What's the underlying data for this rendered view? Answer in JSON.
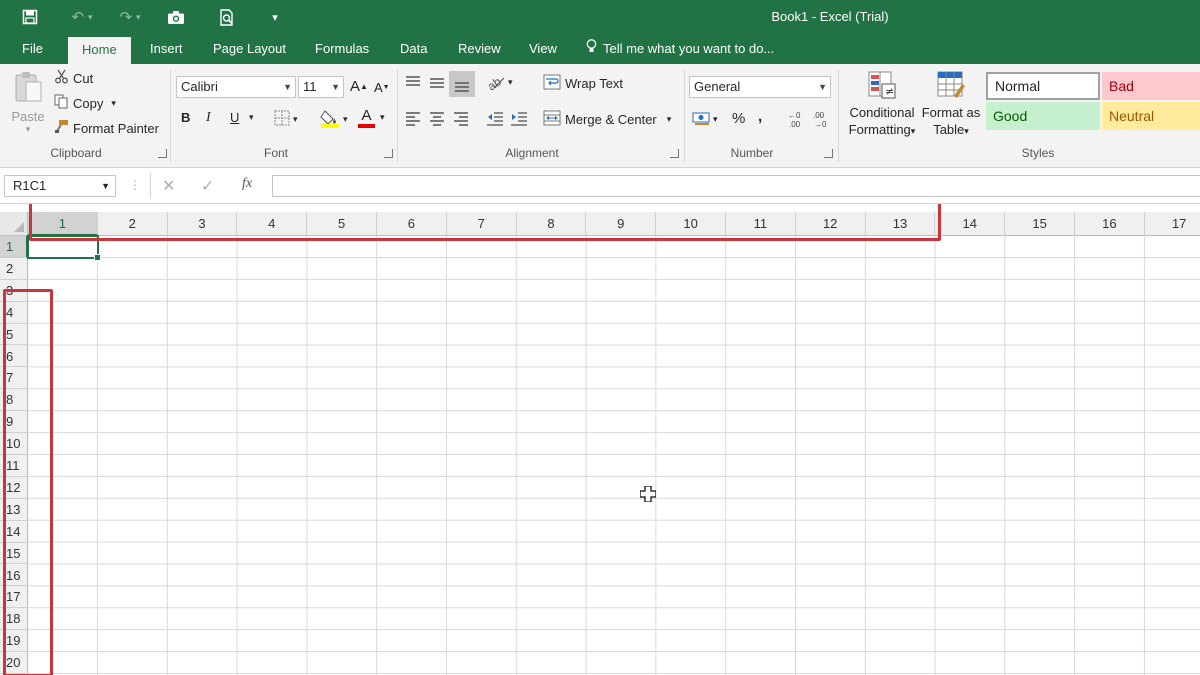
{
  "window": {
    "title": "Book1 - Excel (Trial)"
  },
  "quick_access": {
    "save_icon": "save-icon",
    "undo_icon": "undo-icon",
    "redo_icon": "redo-icon",
    "camera_icon": "camera-icon",
    "print_preview_icon": "print-preview-icon",
    "customize_icon": "customize-qat-icon"
  },
  "tabs": [
    "File",
    "Home",
    "Insert",
    "Page Layout",
    "Formulas",
    "Data",
    "Review",
    "View"
  ],
  "active_tab": "Home",
  "tell_me": "Tell me what you want to do...",
  "ribbon": {
    "clipboard": {
      "paste": "Paste",
      "cut": "Cut",
      "copy": "Copy",
      "format_painter": "Format Painter",
      "label": "Clipboard"
    },
    "font": {
      "name": "Calibri",
      "size": "11",
      "bold": "B",
      "italic": "I",
      "underline": "U",
      "grow": "A",
      "shrink": "A",
      "font_color_letter": "A",
      "label": "Font"
    },
    "alignment": {
      "wrap_text": "Wrap Text",
      "merge_center": "Merge & Center",
      "label": "Alignment"
    },
    "number": {
      "format": "General",
      "percent": "%",
      "comma": ",",
      "label": "Number"
    },
    "styles": {
      "conditional_formatting_1": "Conditional",
      "conditional_formatting_2": "Formatting",
      "format_as_table_1": "Format as",
      "format_as_table_2": "Table",
      "normal": "Normal",
      "bad": "Bad",
      "good": "Good",
      "neutral": "Neutral",
      "label": "Styles",
      "colors": {
        "normal_bg": "#ffffff",
        "bad_bg": "#ffc7ce",
        "bad_fg": "#9c0006",
        "good_bg": "#c6efce",
        "good_fg": "#006100",
        "neutral_bg": "#ffeb9c",
        "neutral_fg": "#9c5700"
      }
    }
  },
  "formula_bar": {
    "name_box": "R1C1",
    "fx": "fx",
    "value": ""
  },
  "grid": {
    "columns": [
      "1",
      "2",
      "3",
      "4",
      "5",
      "6",
      "7",
      "8",
      "9",
      "10",
      "11",
      "12",
      "13",
      "14",
      "15",
      "16",
      "17"
    ],
    "rows": [
      "1",
      "2",
      "3",
      "4",
      "5",
      "6",
      "7",
      "8",
      "9",
      "10",
      "11",
      "12",
      "13",
      "14",
      "15",
      "16",
      "17",
      "18",
      "19",
      "20"
    ],
    "selected_cell": "R1C1"
  },
  "colors": {
    "accent": "#217346",
    "highlight": "#c7363d"
  }
}
